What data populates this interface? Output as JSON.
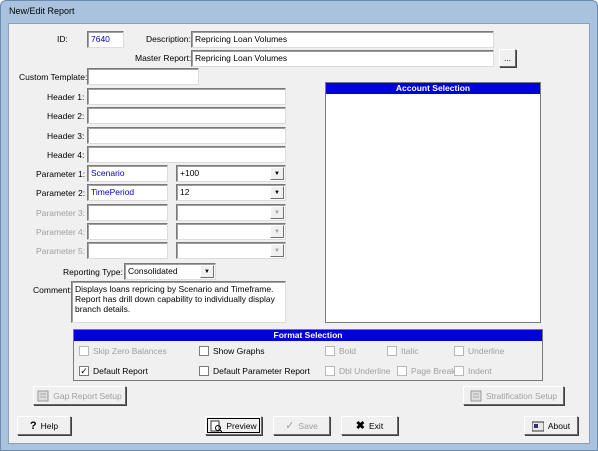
{
  "window": {
    "title": "New/Edit Report"
  },
  "fields": {
    "id_label": "ID:",
    "id_value": "7640",
    "description_label": "Description:",
    "description_value": "Repricing Loan Volumes",
    "master_label": "Master Report:",
    "master_value": "Repricing Loan Volumes",
    "browse_label": "...",
    "custom_template_label": "Custom Template:",
    "custom_template_value": "",
    "header1_label": "Header 1:",
    "header2_label": "Header 2:",
    "header3_label": "Header 3:",
    "header4_label": "Header 4:",
    "param1_label": "Parameter 1:",
    "param1_value": "Scenario",
    "param1_select": "+100",
    "param2_label": "Parameter 2:",
    "param2_value": "TimePeriod",
    "param2_select": "12",
    "param3_label": "Parameter 3:",
    "param4_label": "Parameter 4:",
    "param5_label": "Parameter 5:",
    "reporting_type_label": "Reporting Type:",
    "reporting_type_value": "Consolidated",
    "comment_label": "Comment:",
    "comment_value": "Displays loans repricing by Scenario and Timeframe. Report has drill down capability to individually display branch details."
  },
  "account_selection": {
    "title": "Account Selection"
  },
  "format_selection": {
    "title": "Format Selection",
    "skip_zero": "Skip Zero Balances",
    "show_graphs": "Show Graphs",
    "bold": "Bold",
    "italic": "Italic",
    "underline": "Underline",
    "default_report": "Default Report",
    "default_param_report": "Default Parameter Report",
    "dbl_underline": "Dbl Underline",
    "page_break": "Page Break",
    "indent": "Indent"
  },
  "buttons": {
    "gap_report_setup": "Gap Report Setup",
    "stratification_setup": "Stratification Setup",
    "help": "Help",
    "preview": "Preview",
    "save": "Save",
    "exit": "Exit",
    "about": "About"
  }
}
